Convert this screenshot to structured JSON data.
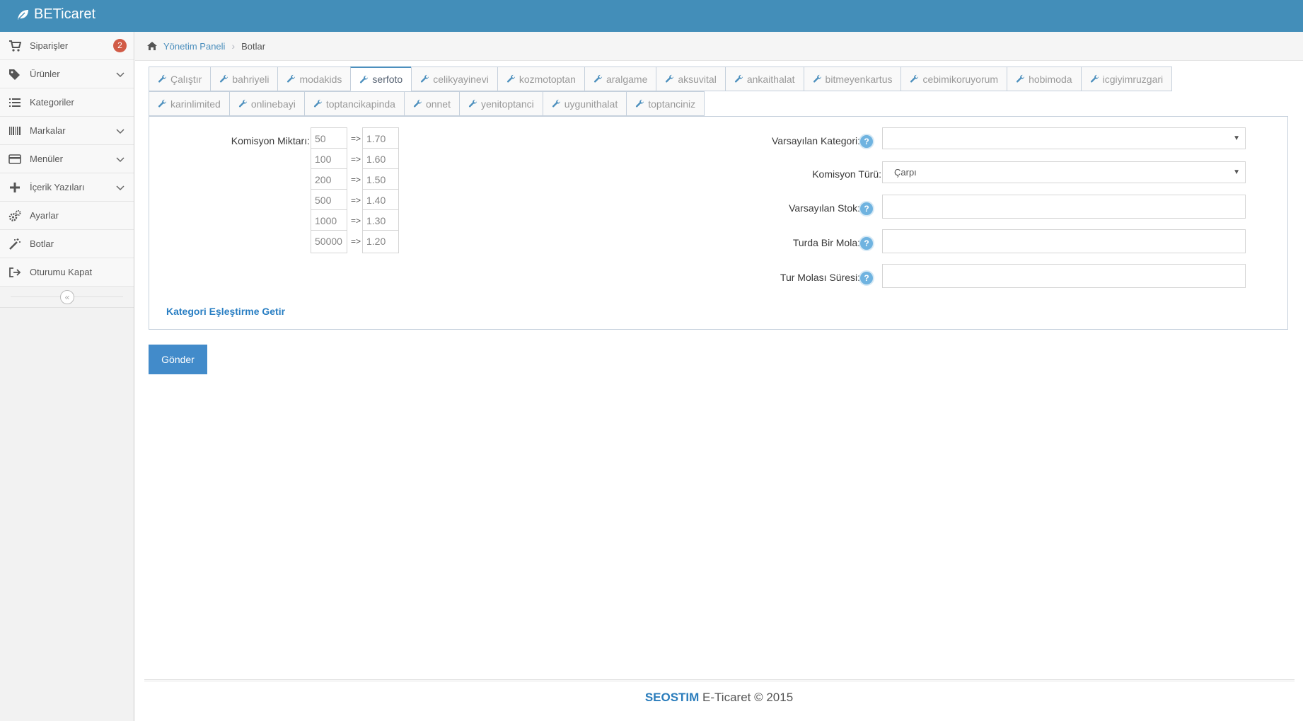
{
  "navbar": {
    "brand": "BETicaret"
  },
  "sidebar": {
    "items": [
      {
        "label": "Siparişler",
        "icon": "cart-icon",
        "badge": "2"
      },
      {
        "label": "Ürünler",
        "icon": "tags-icon",
        "has_submenu": true
      },
      {
        "label": "Kategoriler",
        "icon": "list-icon"
      },
      {
        "label": "Markalar",
        "icon": "barcode-icon",
        "has_submenu": true
      },
      {
        "label": "Menüler",
        "icon": "credit-card-icon",
        "has_submenu": true
      },
      {
        "label": "İçerik Yazıları",
        "icon": "plus-icon",
        "has_submenu": true
      },
      {
        "label": "Ayarlar",
        "icon": "cogs-icon"
      },
      {
        "label": "Botlar",
        "icon": "magic-wand-icon"
      },
      {
        "label": "Oturumu Kapat",
        "icon": "sign-out-icon"
      }
    ],
    "collapse_icon": "double-angle-left-icon"
  },
  "breadcrumb": {
    "home": "Yönetim Paneli",
    "current": "Botlar"
  },
  "tabs": {
    "active": "serfoto",
    "row1": [
      "Çalıştır",
      "bahriyeli",
      "modakids",
      "serfoto",
      "celikyayinevi",
      "kozmotoptan",
      "aralgame",
      "aksuvital",
      "ankaithalat",
      "bitmeyenkartus",
      "cebimikoruyorum",
      "hobimoda",
      "icgiyimruzgari"
    ],
    "row2": [
      "karinlimited",
      "onlinebayi",
      "toptancikapinda",
      "onnet",
      "yenitoptanci",
      "uygunithalat",
      "toptanciniz"
    ]
  },
  "form": {
    "komisyon": {
      "label": "Komisyon Miktarı:",
      "arrow": "=>",
      "rows": [
        {
          "amount": "50",
          "rate": "1.70"
        },
        {
          "amount": "100",
          "rate": "1.60"
        },
        {
          "amount": "200",
          "rate": "1.50"
        },
        {
          "amount": "500",
          "rate": "1.40"
        },
        {
          "amount": "1000",
          "rate": "1.30"
        },
        {
          "amount": "50000",
          "rate": "1.20"
        }
      ]
    },
    "varsayilan_kategori": {
      "label": "Varsayılan Kategori:",
      "value": ""
    },
    "komisyon_turu": {
      "label": "Komisyon Türü:",
      "value": "Çarpı"
    },
    "varsayilan_stok": {
      "label": "Varsayılan Stok:",
      "value": ""
    },
    "turda_bir_mola": {
      "label": "Turda Bir Mola:",
      "value": ""
    },
    "tur_molasi_suresi": {
      "label": "Tur Molası Süresi:",
      "value": ""
    },
    "help_glyph": "?",
    "kategori_link": "Kategori Eşleştirme Getir",
    "submit": "Gönder"
  },
  "footer": {
    "brand": "SEOSTIM",
    "text": " E-Ticaret © 2015"
  },
  "colors": {
    "navbar": "#438eb9",
    "badge": "#d15b47",
    "help": "#6fb3e0",
    "button": "#428bca",
    "link": "#2b7dbc"
  }
}
